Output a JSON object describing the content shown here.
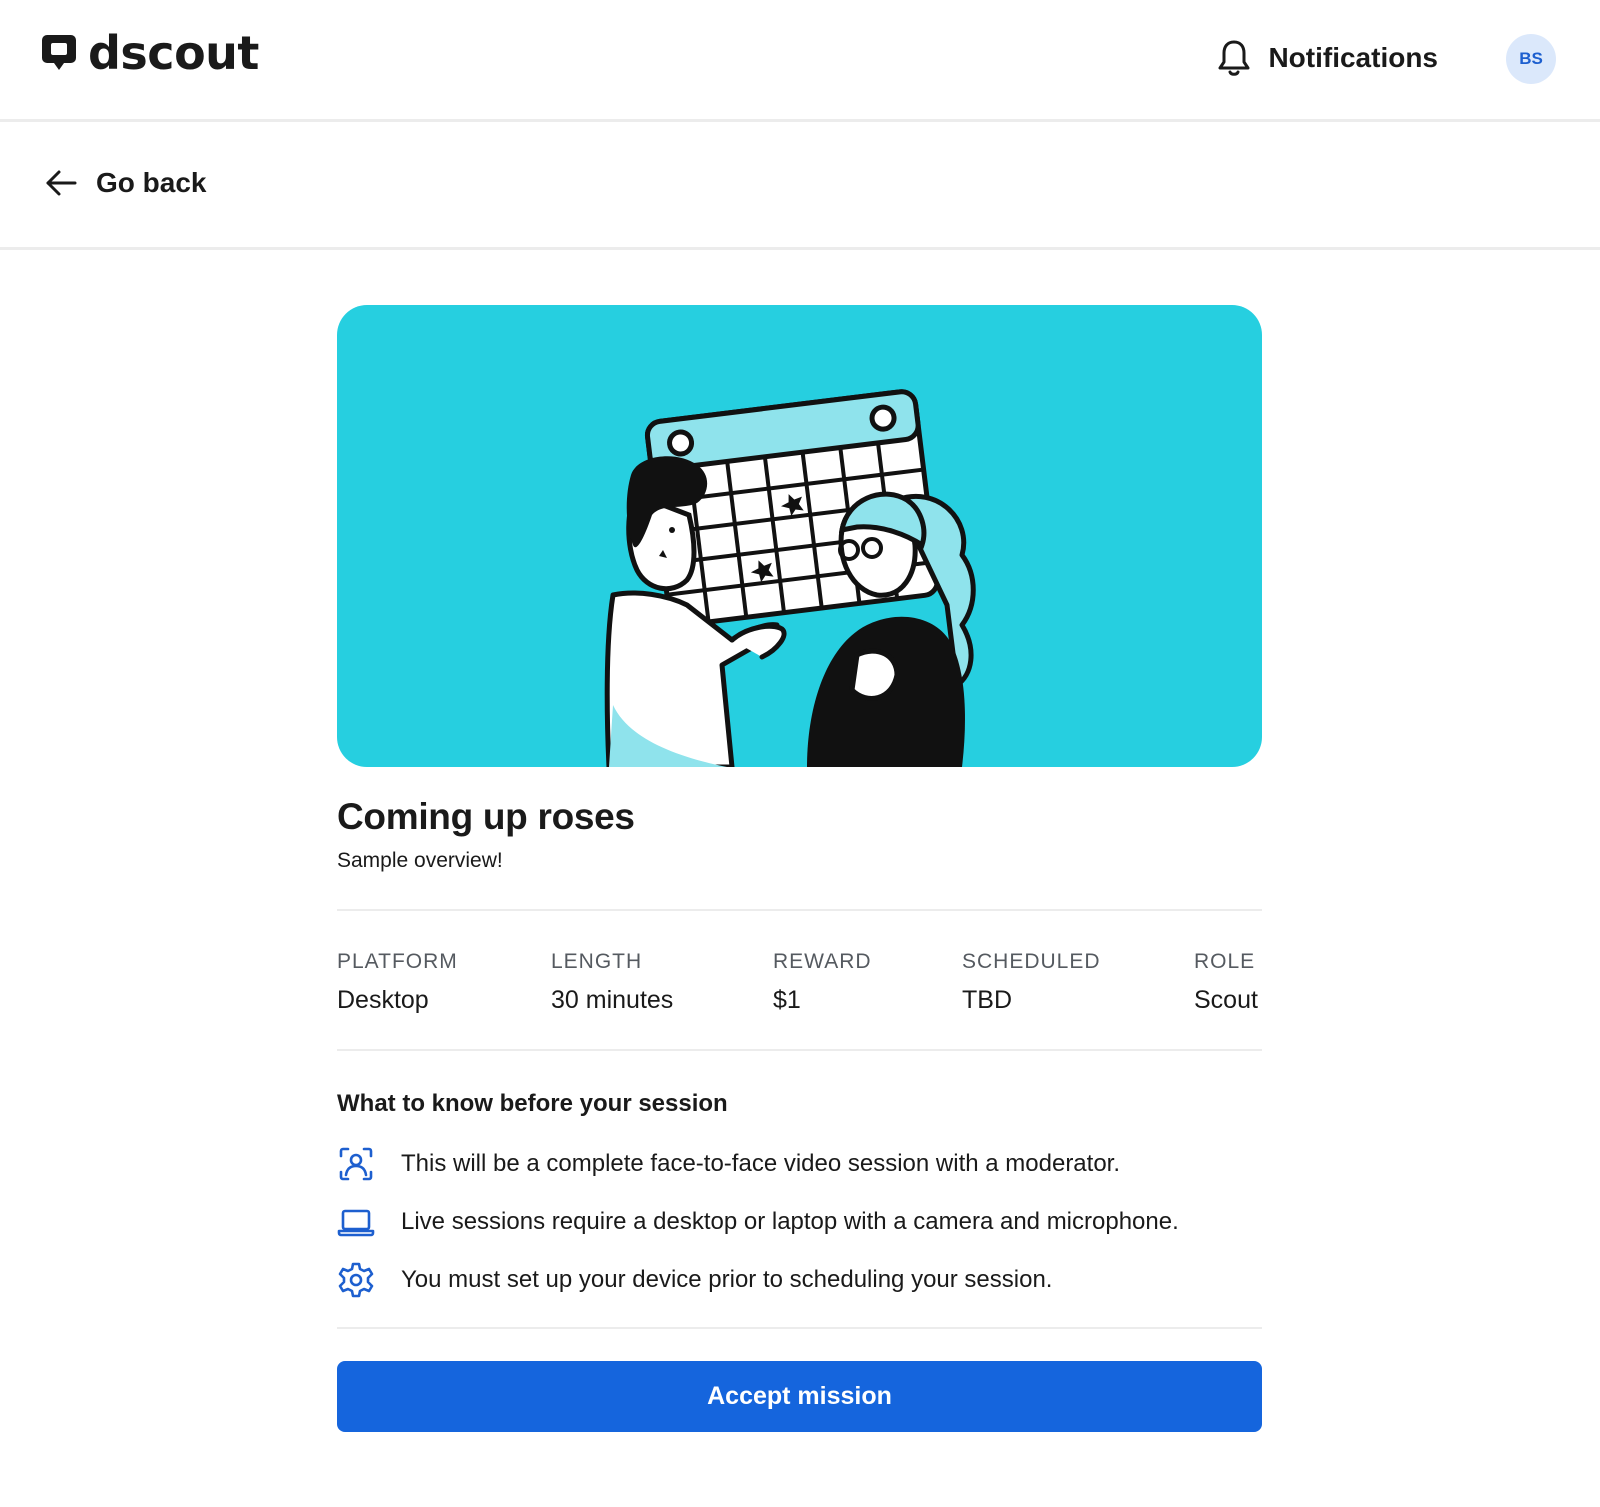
{
  "header": {
    "brand": "dscout",
    "notifications_label": "Notifications",
    "avatar_initials": "BS"
  },
  "nav": {
    "back_label": "Go back"
  },
  "mission": {
    "title": "Coming up roses",
    "subtitle": "Sample overview!",
    "hero_color": "#26cfe0",
    "meta": [
      {
        "key": "PLATFORM",
        "value": "Desktop"
      },
      {
        "key": "LENGTH",
        "value": "30 minutes"
      },
      {
        "key": "REWARD",
        "value": "$1"
      },
      {
        "key": "SCHEDULED",
        "value": "TBD"
      },
      {
        "key": "ROLE",
        "value": "Scout"
      }
    ],
    "info_title": "What to know before your session",
    "info_items": [
      {
        "icon": "face-scan-icon",
        "text": "This will be a complete face-to-face video session with a moderator."
      },
      {
        "icon": "laptop-icon",
        "text": "Live sessions require a desktop or laptop with a camera and microphone."
      },
      {
        "icon": "gear-icon",
        "text": "You must set up your device prior to scheduling your session."
      }
    ],
    "accept_label": "Accept mission"
  },
  "colors": {
    "accent": "#1565dd",
    "icon_blue": "#1d5fcf",
    "avatar_bg": "#dbe8fb"
  }
}
